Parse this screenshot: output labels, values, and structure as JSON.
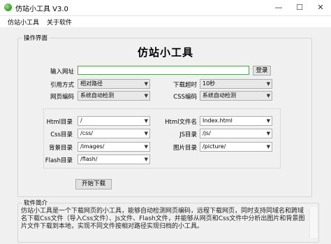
{
  "window": {
    "title": "仿站小工具 V3.0",
    "minimize": "—",
    "maximize": "☐",
    "close": "✕"
  },
  "menu": [
    "仿站小工具",
    "关于软件"
  ],
  "operation": {
    "group_title": "操作界面",
    "heading": "仿站小工具",
    "url_label": "输入网址",
    "url_value": "",
    "login_button": "登录",
    "ref_label": "引用方式",
    "ref_value": "相对路径",
    "timeout_label": "下载超时",
    "timeout_value": "10秒",
    "page_enc_label": "网页编码",
    "page_enc_value": "系统自动检测",
    "css_enc_label": "CSS编码",
    "css_enc_value": "系统自动检测",
    "html_dir_label": "Html目录",
    "html_dir_value": "/",
    "html_file_label": "Html文件名",
    "html_file_value": "Index.html",
    "css_dir_label": "Css目录",
    "css_dir_value": "/css/",
    "js_dir_label": "JS目录",
    "js_dir_value": "/js/",
    "bg_dir_label": "背景目录",
    "bg_dir_value": "/images/",
    "pic_dir_label": "图片目录",
    "pic_dir_value": "/picture/",
    "flash_dir_label": "Flash目录",
    "flash_dir_value": "/flash/",
    "start_button": "开始下载"
  },
  "intro": {
    "group_title": "软件简介",
    "text": "仿站小工具是一个下载网页的小工具，能够自动检测网页编码，远程下载网页，同时支持同域名和跨域名下载Css文件（导入Css文件）、Js文件、Flash文件，并能够从网页和Css文件中分析出图片和背景图片文件下载到本地，实现不同文件按相对路径实现归档的小工具。"
  },
  "colors": {
    "accent_border": "#5aa15a",
    "window_bg": "#f0f0f0"
  }
}
